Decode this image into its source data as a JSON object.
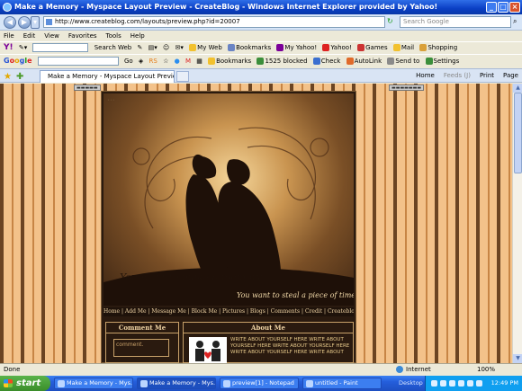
{
  "window": {
    "title": "Make a Memory - Myspace Layout Preview - CreateBlog - Windows Internet Explorer provided by Yahoo!"
  },
  "address_bar": {
    "url": "http://www.createblog.com/layouts/preview.php?id=20007",
    "search_placeholder": "Search Google"
  },
  "menu": [
    "File",
    "Edit",
    "View",
    "Favorites",
    "Tools",
    "Help"
  ],
  "yahoo_toolbar": {
    "search_button": "Search Web",
    "items": [
      "My Web",
      "Bookmarks",
      "My Yahoo!",
      "Yahoo!",
      "Games",
      "Mail",
      "Shopping"
    ]
  },
  "google_toolbar": {
    "logo": "Google",
    "go": "Go",
    "items": [
      "Bookmarks",
      "1525 blocked",
      "Check",
      "AutoLink",
      "Send to",
      "Settings"
    ]
  },
  "tab": {
    "title": "Make a Memory - Myspace Layout Preview - CreateBlog",
    "commands": [
      "Home",
      "Feeds (J)",
      "Print",
      "Page"
    ]
  },
  "layout_preview": {
    "banner_line1": "You want to make a memory",
    "banner_line2": "You want to steal a piece of time",
    "nav": "Home | Add Me | Message Me | Block Me | Pictures | Blogs | Comments | Credit | Createblog",
    "comment_header": "Comment Me",
    "comment_box": "comment.",
    "about_header": "About Me",
    "about_text": "WRITE ABOUT YOURSELF HERE WRITE ABOUT YOURSELF HERE WRITE ABOUT YOURSELF HERE WRITE ABOUT YOURSELF HERE WRITE ABOUT"
  },
  "status_bar": {
    "status": "Done",
    "zone": "Internet",
    "zoom": "100%"
  },
  "taskbar": {
    "start": "start",
    "tasks": [
      "Make a Memory - Mys...",
      "Make a Memory - Mys...",
      "preview[1] - Notepad",
      "untitled - Paint"
    ],
    "desktop": "Desktop",
    "clock": "12:49 PM"
  }
}
